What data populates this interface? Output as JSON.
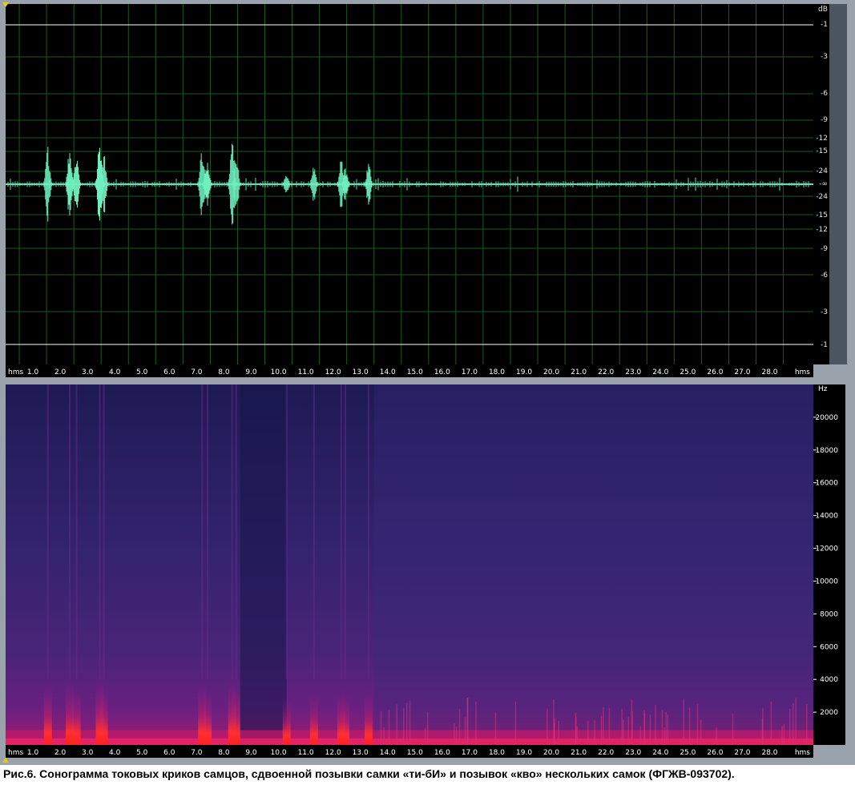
{
  "chart_data": [
    {
      "type": "area",
      "panel": "waveform",
      "unit_label": "dB",
      "db_ticks_top": [
        "-1",
        "-3",
        "-6",
        "-9",
        "-12",
        "-15",
        "-24",
        "-∞"
      ],
      "db_ticks_bottom": [
        "-24",
        "-15",
        "-12",
        "-9",
        "-6",
        "-3",
        "-1"
      ],
      "time_axis_label": "hms",
      "time_ticks": [
        "1.0",
        "2.0",
        "3.0",
        "4.0",
        "5.0",
        "6.0",
        "7.0",
        "8.0",
        "9.0",
        "10.0",
        "11.0",
        "12.0",
        "13.0",
        "14.0",
        "15.0",
        "16.0",
        "17.0",
        "18.0",
        "19.0",
        "20.0",
        "21.0",
        "22.0",
        "23.0",
        "24.0",
        "25.0",
        "26.0",
        "27.0",
        "28.0"
      ],
      "xlim": [
        0,
        29.6
      ],
      "grid": true,
      "bursts": [
        {
          "t": 1.55,
          "amp": 0.85
        },
        {
          "t": 2.35,
          "amp": 0.88
        },
        {
          "t": 2.6,
          "amp": 0.7
        },
        {
          "t": 3.45,
          "amp": 1.0
        },
        {
          "t": 3.6,
          "amp": 0.75
        },
        {
          "t": 7.2,
          "amp": 0.85
        },
        {
          "t": 7.4,
          "amp": 0.6
        },
        {
          "t": 8.3,
          "amp": 1.0
        },
        {
          "t": 8.45,
          "amp": 0.8
        },
        {
          "t": 10.3,
          "amp": 0.25
        },
        {
          "t": 11.3,
          "amp": 0.45
        },
        {
          "t": 12.3,
          "amp": 0.55
        },
        {
          "t": 12.45,
          "amp": 0.4
        },
        {
          "t": 13.3,
          "amp": 0.5
        }
      ]
    },
    {
      "type": "heatmap",
      "panel": "spectrogram",
      "unit_label": "Hz",
      "freq_ticks": [
        "20000",
        "18000",
        "16000",
        "14000",
        "12000",
        "10000",
        "8000",
        "6000",
        "4000",
        "2000"
      ],
      "ylim": [
        0,
        22000
      ],
      "time_axis_label": "hms",
      "time_ticks": [
        "1.0",
        "2.0",
        "3.0",
        "4.0",
        "5.0",
        "6.0",
        "7.0",
        "8.0",
        "9.0",
        "10.0",
        "11.0",
        "12.0",
        "13.0",
        "14.0",
        "15.0",
        "16.0",
        "17.0",
        "18.0",
        "19.0",
        "20.0",
        "21.0",
        "22.0",
        "23.0",
        "24.0",
        "25.0",
        "26.0",
        "27.0",
        "28.0"
      ],
      "xlim": [
        0,
        29.6
      ],
      "colors": {
        "background": "#2a1a6a",
        "mid": "#7a1a8a",
        "hot": "#ff2a2a"
      }
    }
  ],
  "caption": "Рис.6. Сонограмма токовых криков самцов, сдвоенной позывки самки «ти-бИ» и позывок «кво» нескольких самок (ФГЖВ-093702)."
}
